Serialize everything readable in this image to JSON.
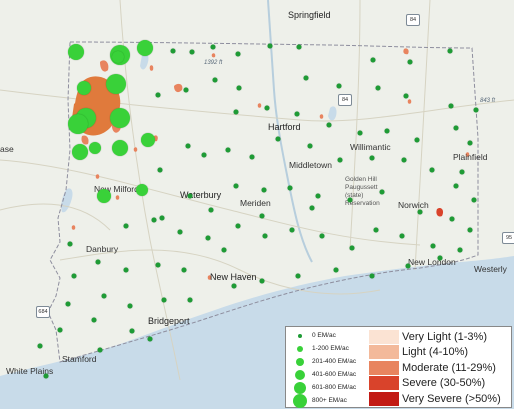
{
  "places": {
    "springfield": "Springfield",
    "hartford": "Hartford",
    "waterbury": "Waterbury",
    "new_milford": "New Milford",
    "meriden": "Meriden",
    "middletown": "Middletown",
    "willimantic": "Willimantic",
    "plainfield": "Plainfield",
    "danbury": "Danbury",
    "norwich": "Norwich",
    "new_haven": "New Haven",
    "new_london": "New London",
    "westerly": "Westerly",
    "bridgeport": "Bridgeport",
    "stamford": "Stamford",
    "white_plains": "White Plains",
    "golden_hill": "Golden Hill\nPaugussett\n(state)\nReservation",
    "ase": "ase"
  },
  "elevations": {
    "e1": "1392 ft",
    "e2": "843 ft"
  },
  "highways": {
    "h1": "84",
    "h2": "84",
    "h3": "684",
    "h4": "95"
  },
  "legend": {
    "density": [
      {
        "label": "0 EM/ac",
        "color": "#1e9b35"
      },
      {
        "label": "1-200 EM/ac",
        "color": "#39d139"
      },
      {
        "label": "201-400 EM/ac",
        "color": "#39d139"
      },
      {
        "label": "401-600 EM/ac",
        "color": "#39d139"
      },
      {
        "label": "601-800 EM/ac",
        "color": "#39d139"
      },
      {
        "label": "800+ EM/ac",
        "color": "#39d139"
      }
    ],
    "severity": [
      {
        "label": "Very Light (1-3%)",
        "color": "#fbe3d3"
      },
      {
        "label": "Light (4-10%)",
        "color": "#f3b99a"
      },
      {
        "label": "Moderate (11-29%)",
        "color": "#e8845f"
      },
      {
        "label": "Severe (30-50%)",
        "color": "#d9432b"
      },
      {
        "label": "Very Severe (>50%)",
        "color": "#c21a14"
      }
    ]
  },
  "colors": {
    "site_zero": "#1e9b35",
    "site_high": "#39d139",
    "damage": "#e07a3c",
    "water": "#c8dbe9",
    "land": "#eef0ea",
    "boundary": "#8e8e9e"
  },
  "map_type": "egg mass (EM/ac) survey sites and defoliation severity over Connecticut basemap",
  "survey_sites": [
    {
      "cls": 4
    },
    {
      "cls": 5
    },
    {
      "cls": 4
    },
    {
      "cls": 3
    },
    {
      "cls": 5
    },
    {
      "cls": 5
    },
    {
      "cls": 5
    },
    {
      "cls": 5
    },
    {
      "cls": 4
    },
    {
      "cls": 4
    },
    {
      "cls": 2
    },
    {
      "cls": 3
    },
    {
      "cls": 3
    },
    {
      "cls": 2
    },
    {
      "cls": 2
    }
  ]
}
